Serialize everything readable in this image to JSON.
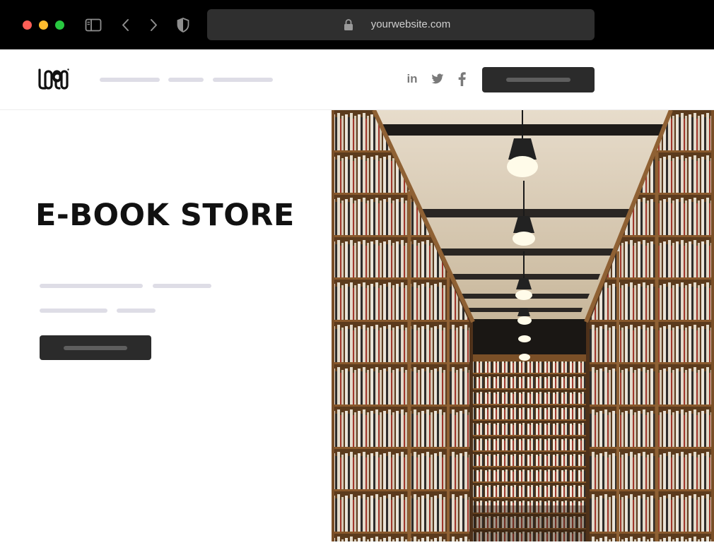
{
  "browser": {
    "url": "yourwebsite.com",
    "icons": [
      "sidebar-icon",
      "back-icon",
      "forward-icon",
      "shield-icon",
      "lock-icon"
    ]
  },
  "nav": {
    "logo_text": "LOGO",
    "social_icons": [
      "linkedin-icon",
      "twitter-icon",
      "facebook-icon"
    ],
    "linkedin_label": "in"
  },
  "hero": {
    "title": "E-BOOK STORE",
    "image": "bookstore-aisle-photo"
  }
}
